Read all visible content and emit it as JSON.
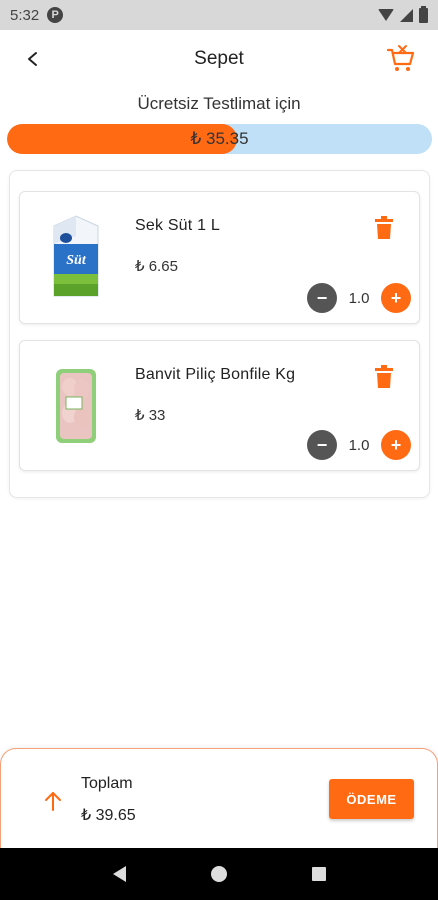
{
  "status_bar": {
    "time": "5:32",
    "app_icon": "P"
  },
  "header": {
    "title": "Sepet"
  },
  "free_delivery": {
    "label": "Ücretsiz Testlimat için",
    "amount": "₺ 35.35",
    "progress": 0.54
  },
  "cart": {
    "items": [
      {
        "name": "Sek Süt 1 L",
        "price": "₺ 6.65",
        "quantity": "1.0",
        "image": "milk-carton"
      },
      {
        "name": "Banvit Piliç Bonfile Kg",
        "price": "₺ 33",
        "quantity": "1.0",
        "image": "chicken-tray"
      }
    ]
  },
  "summary": {
    "total_label": "Toplam",
    "total_value": "₺ 39.65",
    "pay_label": "ÖDEME"
  },
  "colors": {
    "accent": "#ff6a13",
    "progress_track": "#bfe0f7",
    "minus_button": "#555555"
  }
}
